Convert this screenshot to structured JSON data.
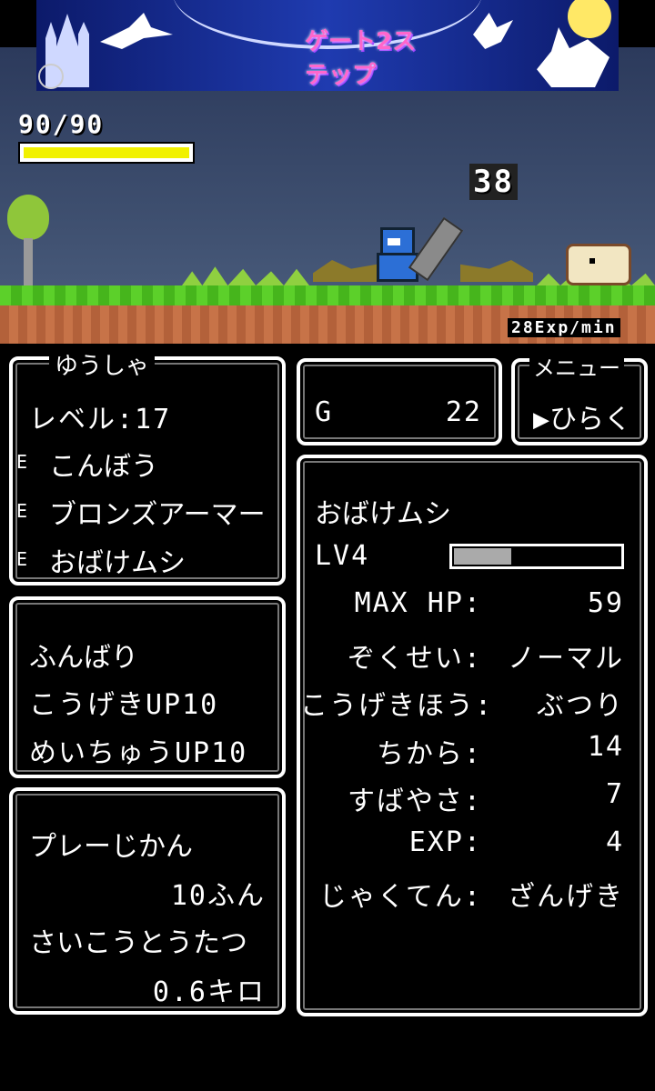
{
  "ad": {
    "logo_text": "ゲート2ステップ"
  },
  "hud": {
    "hp_text": "90/90",
    "hp_fraction": 1.0,
    "damage_text": "38",
    "exp_rate": "28Exp/min"
  },
  "hero": {
    "title": "ゆうしゃ",
    "level": "レベル:17",
    "equip_marker": "E",
    "equipment": [
      "こんぼう",
      "ブロンズアーマー",
      "おばけムシ"
    ]
  },
  "skills": [
    "ふんばり",
    "こうげきUP10",
    "めいちゅうUP10"
  ],
  "stats_box": {
    "play_time_label": "プレーじかん",
    "play_time_value": "10ふん",
    "max_distance_label": "さいこうとうたつ",
    "max_distance_value": "0.6キロ"
  },
  "gold": {
    "label": "G",
    "value": "22"
  },
  "menu": {
    "title": "メニュー",
    "open_label": "▶ひらく"
  },
  "monster": {
    "name": "おばけムシ",
    "level": "LV4",
    "exp_fraction": 0.35,
    "rows": [
      {
        "label": "MAX HP:",
        "value": "59"
      },
      {
        "label": "ぞくせい:",
        "value": "ノーマル"
      },
      {
        "label": "こうげきほう:",
        "value": "ぶつり"
      },
      {
        "label": "ちから:",
        "value": "14"
      },
      {
        "label": "すばやさ:",
        "value": "7"
      },
      {
        "label": "EXP:",
        "value": "4"
      },
      {
        "label": "じゃくてん:",
        "value": "ざんげき"
      }
    ]
  },
  "colors": {
    "hp_bar": "#f1f100",
    "grass": "#5cd02a",
    "dirt": "#b3613a",
    "sky": "#3f5070"
  }
}
